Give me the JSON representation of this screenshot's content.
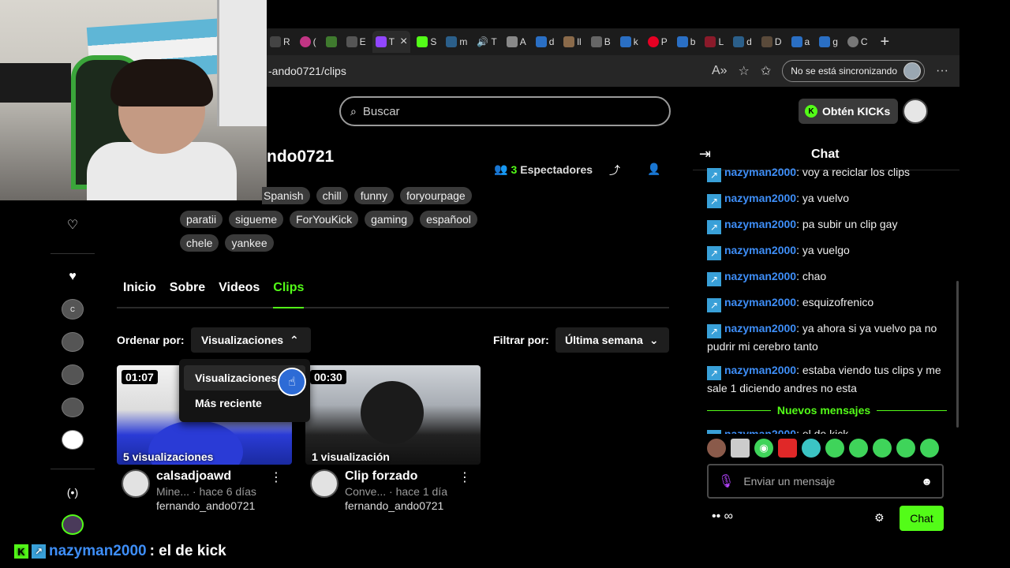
{
  "browser": {
    "tabs": [
      {
        "label": "R",
        "color": "#444"
      },
      {
        "label": "(",
        "color": "#c13584"
      },
      {
        "label": "",
        "color": "#3f7a2e"
      },
      {
        "label": "E",
        "color": "#555"
      },
      {
        "label": "T",
        "color": "#9146ff"
      }
    ],
    "active_tab_close": "×",
    "more_tabs": [
      "S",
      "m",
      "T",
      "A",
      "d",
      "ll",
      "B",
      "k",
      "P",
      "b",
      "L",
      "d",
      "D",
      "a",
      "g",
      "C"
    ],
    "new_tab": "+",
    "url": "-ando0721/clips",
    "sync_label": "No se está sincronizando"
  },
  "search": {
    "placeholder": "Buscar"
  },
  "kicks_button": "Obtén KICKs",
  "channel": {
    "name": "ndo0721",
    "viewers_count": "3",
    "viewers_label": "Espectadores",
    "tags": [
      "Spanish",
      "chill",
      "funny",
      "foryourpage",
      "paratii",
      "sigueme",
      "ForYouKick",
      "gaming",
      "españool",
      "chele",
      "yankee"
    ]
  },
  "nav": {
    "tabs": [
      "Inicio",
      "Sobre",
      "Videos",
      "Clips"
    ],
    "active": "Clips"
  },
  "sort": {
    "label": "Ordenar por:",
    "value": "Visualizaciones",
    "options": [
      "Visualizaciones",
      "Más reciente"
    ]
  },
  "filter": {
    "label": "Filtrar por:",
    "value": "Última semana"
  },
  "clips": [
    {
      "duration": "01:07",
      "views": "5 visualizaciones",
      "title": "calsadjoawd",
      "category": "Mine...",
      "age": "hace 6 días",
      "author": "fernando_ando0721"
    },
    {
      "duration": "00:30",
      "views": "1 visualización",
      "title": "Clip forzado",
      "category": "Conve...",
      "age": "hace 1 día",
      "author": "fernando_ando0721"
    }
  ],
  "chat": {
    "title": "Chat",
    "messages": [
      {
        "user": "nazyman2000",
        "text": ": voy a reciclar los clips"
      },
      {
        "user": "nazyman2000",
        "text": ": ya vuelvo"
      },
      {
        "user": "nazyman2000",
        "text": ": pa subir un clip gay"
      },
      {
        "user": "nazyman2000",
        "text": ": ya vuelgo"
      },
      {
        "user": "nazyman2000",
        "text": ": chao"
      },
      {
        "user": "nazyman2000",
        "text": ": esquizofrenico"
      },
      {
        "user": "nazyman2000",
        "text": ": ya ahora si ya vuelvo pa no pudrir mi cerebro tanto"
      },
      {
        "user": "nazyman2000",
        "text": ": estaba viendo tus clips y me sale 1 diciendo andres no esta"
      }
    ],
    "new_messages_label": "Nuevos mensajes",
    "new_message": {
      "user": "nazyman2000",
      "text": ": el de kick"
    },
    "input_placeholder": "Enviar un mensaje",
    "send_label": "Chat",
    "footer_icons": "•• ∞"
  },
  "overlay": {
    "user": "nazyman2000",
    "text": ": el de kick"
  },
  "colors": {
    "accent": "#53fc18",
    "username": "#3e8ef7",
    "mic": "#b544ff"
  }
}
